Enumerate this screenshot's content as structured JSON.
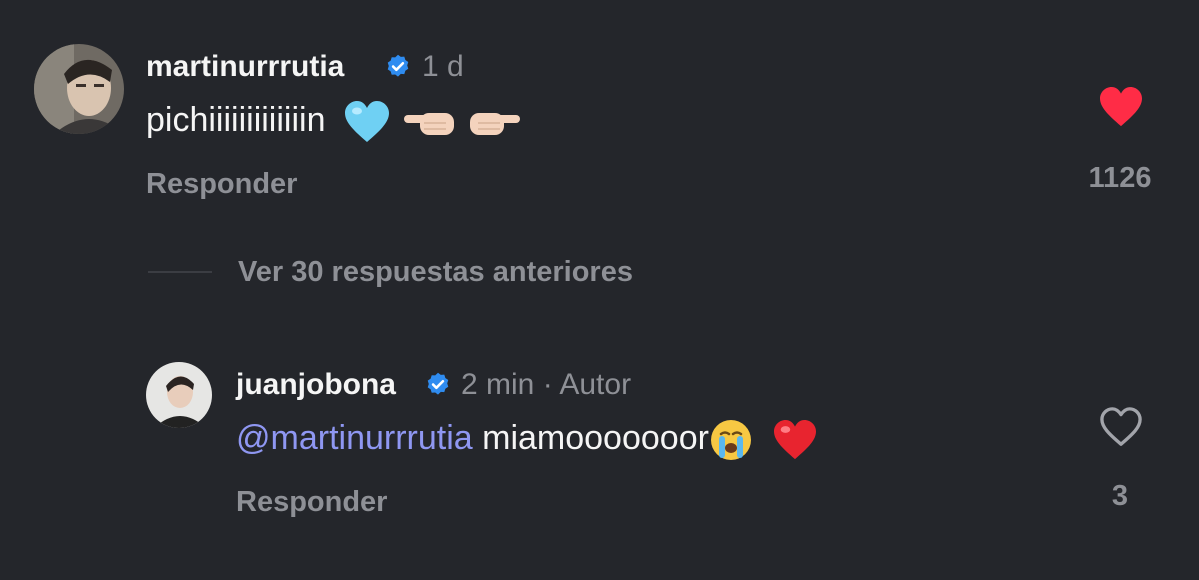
{
  "comments": [
    {
      "username": "martinurrrutia",
      "time": "1 d",
      "text": "pichiiiiiiiiiiiiin",
      "reply_label": "Responder",
      "likes": "1126",
      "liked": true
    },
    {
      "username": "juanjobona",
      "time": "2 min · Autor",
      "mention": "@martinurrrutia",
      "text": "miamooooooor",
      "reply_label": "Responder",
      "likes": "3",
      "liked": false
    }
  ],
  "view_replies_label": "Ver 30 respuestas anteriores",
  "colors": {
    "background": "#24262b",
    "verified": "#2f8cf0",
    "like_red": "#ff2c46",
    "mention": "#8f97f2",
    "muted": "#8e9096"
  },
  "icons": [
    "verified-badge-icon",
    "heart-filled-icon",
    "heart-outline-icon",
    "light-blue-heart-emoji",
    "pointing-left-emoji",
    "loudly-crying-emoji",
    "red-heart-emoji"
  ]
}
